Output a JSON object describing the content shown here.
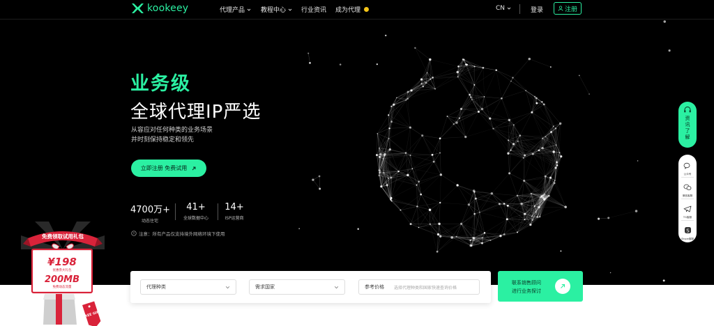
{
  "nav": {
    "logo_text": "kookeey",
    "items": [
      {
        "label": "代理产品",
        "has_dropdown": true
      },
      {
        "label": "教程中心",
        "has_dropdown": true
      },
      {
        "label": "行业资讯",
        "has_dropdown": false
      },
      {
        "label": "成为代理",
        "has_dropdown": false
      }
    ],
    "language": "CN",
    "login": "登录",
    "register": "注册"
  },
  "hero": {
    "title_green": "业务级",
    "title_white": "全球代理IP严选",
    "subtitle_1": "从容应对任何种类的业务场景",
    "subtitle_2": "并时刻保持稳定和领先",
    "cta": "立即注册 免费试用",
    "stats": [
      {
        "value": "4700万+",
        "label": "动态住宅"
      },
      {
        "value": "41+",
        "label": "全球数据中心"
      },
      {
        "value": "14+",
        "label": "ISP运营商"
      }
    ],
    "notice": "注意：所有产品仅支持境外网络环境下使用"
  },
  "search": {
    "proxy_type": "代理种类",
    "country": "需求国家",
    "price_label": "参考价格",
    "price_placeholder": "选择代理种类和国家快速查询价格"
  },
  "contact": {
    "line1": "联系销售顾问",
    "line2": "进行业务探讨"
  },
  "side": {
    "support": "资讯了解",
    "items": [
      {
        "icon": "wechat-icon",
        "label": "公众号"
      },
      {
        "icon": "wechat-service-icon",
        "label": "微信客服"
      },
      {
        "icon": "telegram-icon",
        "label": "TG客服"
      },
      {
        "icon": "skype-icon",
        "label": "Skype客服"
      }
    ]
  },
  "gift": {
    "banner": "免费领取试用礼包",
    "price": "¥198",
    "price_caption": "优惠券大礼包",
    "amount": "200MB",
    "amount_caption": "免费动态流量",
    "tag": "FREE GIFT"
  },
  "colors": {
    "accent": "#2bf0a2",
    "background": "#000000",
    "gift_red": "#d9233a"
  }
}
